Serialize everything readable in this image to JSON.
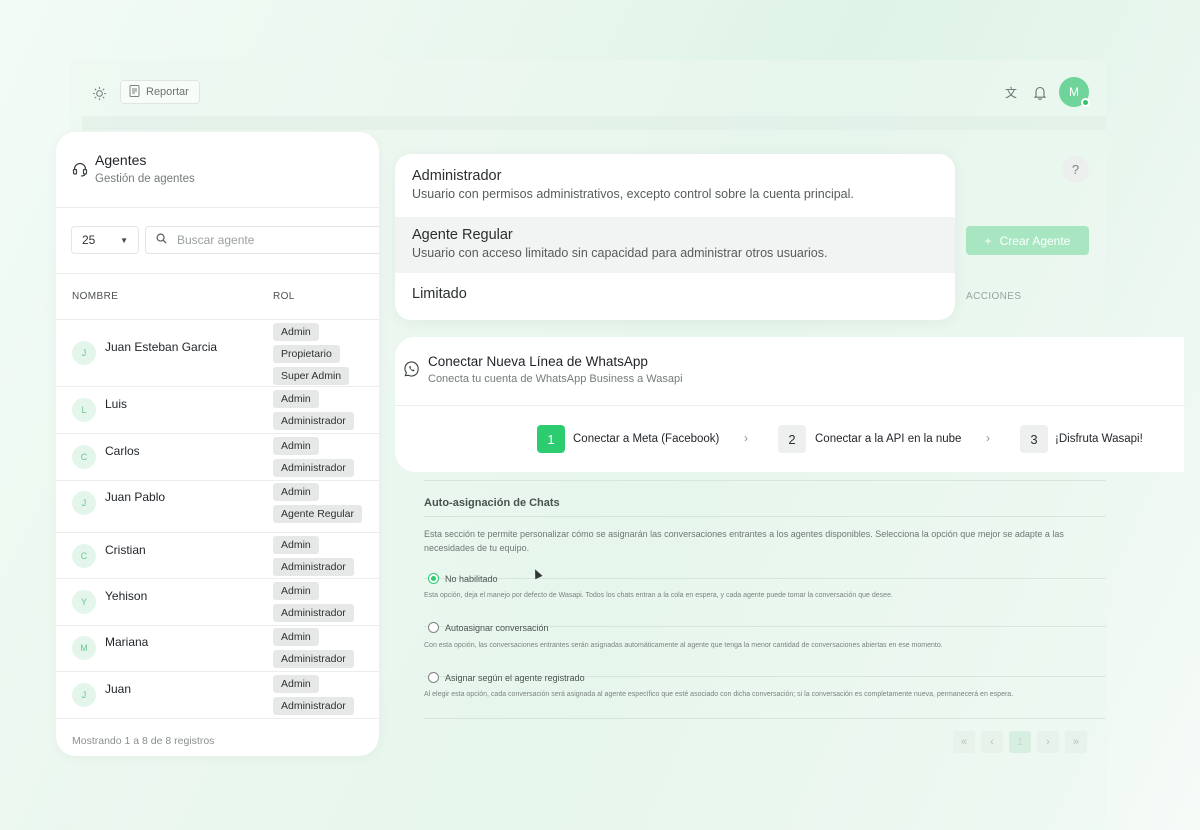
{
  "topbar": {
    "report_label": "Reportar",
    "user_initial": "M"
  },
  "agents_panel": {
    "title": "Agentes",
    "subtitle": "Gestión de agentes",
    "page_size": "25",
    "search_placeholder": "Buscar agente",
    "columns": {
      "name": "NOMBRE",
      "role": "ROL"
    },
    "rows": [
      {
        "initial": "J",
        "name": "Juan Esteban Garcia",
        "roles": [
          "Admin",
          "Propietario",
          "Super Admin"
        ]
      },
      {
        "initial": "L",
        "name": "Luis",
        "roles": [
          "Admin",
          "Administrador"
        ]
      },
      {
        "initial": "C",
        "name": "Carlos",
        "roles": [
          "Admin",
          "Administrador"
        ]
      },
      {
        "initial": "J",
        "name": "Juan Pablo",
        "roles": [
          "Admin",
          "Agente Regular"
        ]
      },
      {
        "initial": "C",
        "name": "Cristian",
        "roles": [
          "Admin",
          "Administrador"
        ]
      },
      {
        "initial": "Y",
        "name": "Yehison",
        "roles": [
          "Admin",
          "Administrador"
        ]
      },
      {
        "initial": "M",
        "name": "Mariana",
        "roles": [
          "Admin",
          "Administrador"
        ]
      },
      {
        "initial": "J",
        "name": "Juan",
        "roles": [
          "Admin",
          "Administrador"
        ]
      }
    ],
    "footer": "Mostrando 1 a 8 de 8 registros"
  },
  "role_menu": {
    "options": [
      {
        "title": "Administrador",
        "description": "Usuario con permisos administrativos, excepto control sobre la cuenta principal."
      },
      {
        "title": "Agente Regular",
        "description": "Usuario con acceso limitado sin capacidad para administrar otros usuarios."
      },
      {
        "title": "Limitado",
        "description": ""
      }
    ],
    "highlighted_index": 1
  },
  "help_label": "?",
  "create_button_label": "Crear Agente",
  "actions_header": "ACCIONES",
  "whatsapp": {
    "title": "Conectar Nueva Línea de WhatsApp",
    "subtitle": "Conecta tu cuenta de WhatsApp Business a Wasapi",
    "steps": [
      {
        "num": "1",
        "label": "Conectar a Meta (Facebook)",
        "done": true
      },
      {
        "num": "2",
        "label": "Conectar a la API en la nube",
        "done": false
      },
      {
        "num": "3",
        "label": "¡Disfruta Wasapi!",
        "done": false
      }
    ]
  },
  "auto_assign": {
    "title": "Auto-asignación de Chats",
    "description": "Esta sección te permite personalizar cómo se asignarán las conversaciones entrantes a los agentes disponibles. Selecciona la opción que mejor se adapte a las necesidades de tu equipo.",
    "options": [
      {
        "label": "No habilitado",
        "note": "Esta opción, deja el manejo por defecto de Wasapi. Todos los chats entran a la cola en espera, y cada agente puede tomar la conversación que desee.",
        "selected": true
      },
      {
        "label": "Autoasignar conversación",
        "note": "Con esta opción, las conversaciones entrantes serán asignadas automáticamente al agente que tenga la menor cantidad de conversaciones abiertas en ese momento.",
        "selected": false
      },
      {
        "label": "Asignar según el agente registrado",
        "note": "Al elegir esta opción, cada conversación será asignada al agente específico que esté asociado con dicha conversación; si la conversación es completamente nueva, permanecerá en espera.",
        "selected": false
      }
    ]
  },
  "pagination": {
    "first": "«",
    "prev": "‹",
    "current": "1",
    "next": "›",
    "last": "»"
  },
  "colors": {
    "accent": "#2ecc71",
    "accent_light": "#a8e6c1"
  }
}
